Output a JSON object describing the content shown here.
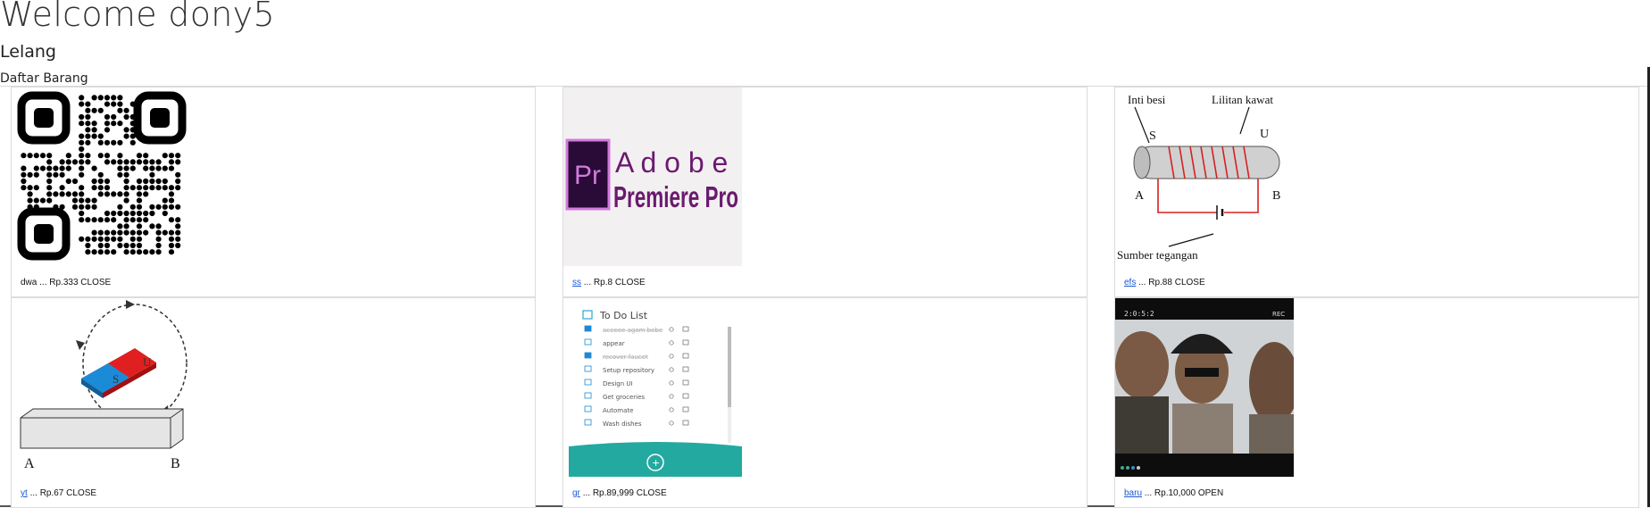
{
  "page": {
    "welcome": "Welcome dony5",
    "section_title": "Lelang",
    "list_title": "Daftar Barang"
  },
  "items": [
    {
      "name": "dwa",
      "link": false,
      "price": "Rp.333",
      "status": "CLOSE",
      "image": "qr-code-image"
    },
    {
      "name": "ss",
      "link": true,
      "price": "Rp.8",
      "status": "CLOSE",
      "image": "adobe-premiere-pro-logo"
    },
    {
      "name": "efs",
      "link": true,
      "price": "Rp.88",
      "status": "CLOSE",
      "image": "electromagnet-diagram"
    },
    {
      "name": "yt",
      "link": true,
      "price": "Rp.67",
      "status": "CLOSE",
      "image": "magnet-rotation-diagram"
    },
    {
      "name": "gr",
      "link": true,
      "price": "Rp.89,999",
      "status": "CLOSE",
      "image": "todo-list-app-screenshot"
    },
    {
      "name": "baru",
      "link": true,
      "price": "Rp.10,000",
      "status": "OPEN",
      "image": "game-characters-screenshot"
    }
  ],
  "separator": "...",
  "images": {
    "premiere": {
      "top": "A d o b e",
      "bottom": "Premiere Pro",
      "badge": "Pr"
    },
    "electromagnet": {
      "inti": "Inti besi",
      "lilitan": "Lilitan kawat",
      "s": "S",
      "u": "U",
      "a": "A",
      "b": "B",
      "sumber": "Sumber tegangan"
    },
    "magnet": {
      "s": "S",
      "u": "U",
      "a": "A",
      "b": "B"
    },
    "todo": {
      "title": "To Do List",
      "tasks": [
        "aceeee agom bebe",
        "appear",
        "recover faucet",
        "Setup repository",
        "Design UI",
        "Get groceries",
        "Automate",
        "Wash dishes"
      ]
    },
    "game": {
      "time": "2:0:5:2",
      "rec": "REC"
    }
  }
}
